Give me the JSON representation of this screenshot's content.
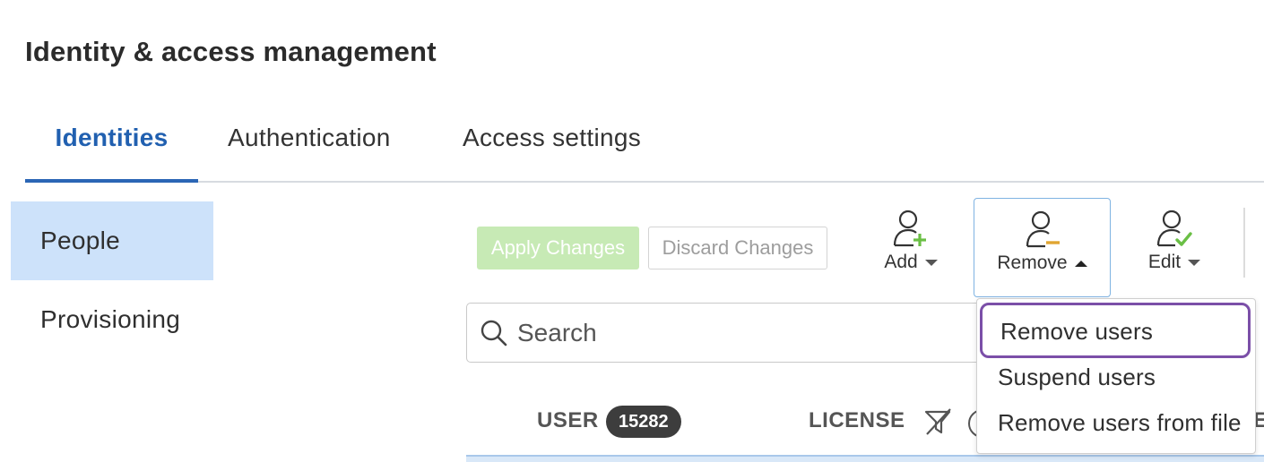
{
  "page": {
    "title": "Identity & access management"
  },
  "tabs": [
    {
      "label": "Identities",
      "active": true
    },
    {
      "label": "Authentication",
      "active": false
    },
    {
      "label": "Access settings",
      "active": false
    }
  ],
  "sidebar": {
    "items": [
      {
        "label": "People",
        "active": true
      },
      {
        "label": "Provisioning",
        "active": false
      }
    ]
  },
  "toolbar": {
    "apply_label": "Apply Changes",
    "discard_label": "Discard Changes",
    "add_label": "Add",
    "remove_label": "Remove",
    "edit_label": "Edit"
  },
  "search": {
    "placeholder": "Search",
    "value": ""
  },
  "table": {
    "columns": {
      "user": "USER",
      "license": "LICENSE",
      "partial": "E"
    },
    "user_count": "15282"
  },
  "remove_menu": {
    "items": [
      {
        "label": "Remove users",
        "highlighted": true
      },
      {
        "label": "Suspend users"
      },
      {
        "label": "Remove users from file"
      }
    ]
  },
  "colors": {
    "accent": "#2160b0",
    "sidebar_active": "#cde2fa",
    "apply_bg": "#c7eab5",
    "add_icon": "#6abf45",
    "remove_icon": "#e0a531",
    "edit_icon": "#6abf45",
    "highlight_border": "#7b4fa8"
  },
  "icons": [
    "add-user-icon",
    "remove-user-icon",
    "edit-user-icon",
    "search-icon",
    "filter-off-icon"
  ]
}
